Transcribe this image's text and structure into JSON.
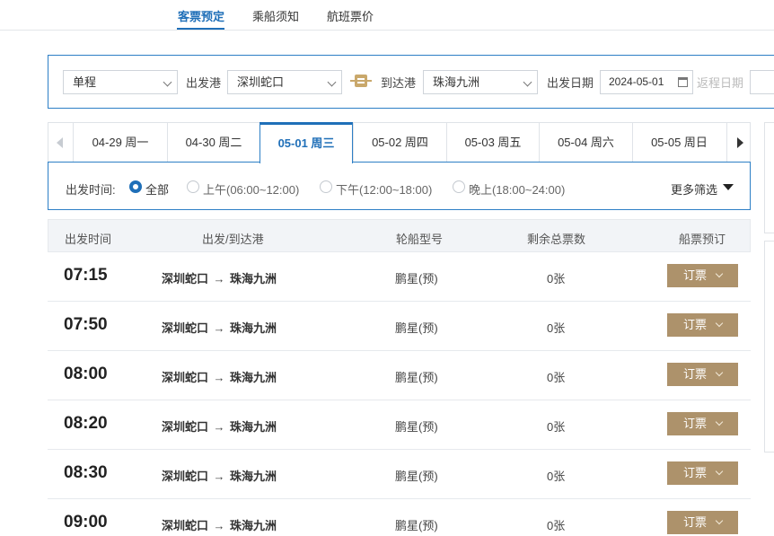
{
  "nav": {
    "items": [
      "客票预定",
      "乘船须知",
      "航班票价"
    ]
  },
  "search": {
    "trip_type": "单程",
    "depart_label": "出发港",
    "depart_value": "深圳蛇口",
    "arrive_label": "到达港",
    "arrive_value": "珠海九洲",
    "date_label": "出发日期",
    "date_value": "2024-05-01",
    "return_label": "返程日期"
  },
  "date_tabs": [
    {
      "label": "04-29 周一"
    },
    {
      "label": "04-30 周二"
    },
    {
      "label": "05-01 周三"
    },
    {
      "label": "05-02 周四"
    },
    {
      "label": "05-03 周五"
    },
    {
      "label": "05-04 周六"
    },
    {
      "label": "05-05 周日"
    }
  ],
  "active_tab": "05-01 周三",
  "filter": {
    "label": "出发时间:",
    "options": [
      {
        "label": "全部",
        "checked": true
      },
      {
        "label": "上午(06:00~12:00)",
        "checked": false
      },
      {
        "label": "下午(12:00~18:00)",
        "checked": false
      },
      {
        "label": "晚上(18:00~24:00)",
        "checked": false
      }
    ],
    "more": "更多筛选"
  },
  "table": {
    "headers": [
      "出发时间",
      "出发/到达港",
      "轮船型号",
      "剩余总票数",
      "船票预订"
    ],
    "rows": [
      {
        "time": "07:15",
        "from": "深圳蛇口",
        "to": "珠海九洲",
        "ship": "鹏星(预)",
        "remaining": "0张",
        "book": "订票"
      },
      {
        "time": "07:50",
        "from": "深圳蛇口",
        "to": "珠海九洲",
        "ship": "鹏星(预)",
        "remaining": "0张",
        "book": "订票"
      },
      {
        "time": "08:00",
        "from": "深圳蛇口",
        "to": "珠海九洲",
        "ship": "鹏星(预)",
        "remaining": "0张",
        "book": "订票"
      },
      {
        "time": "08:20",
        "from": "深圳蛇口",
        "to": "珠海九洲",
        "ship": "鹏星(预)",
        "remaining": "0张",
        "book": "订票"
      },
      {
        "time": "08:30",
        "from": "深圳蛇口",
        "to": "珠海九洲",
        "ship": "鹏星(预)",
        "remaining": "0张",
        "book": "订票"
      },
      {
        "time": "09:00",
        "from": "深圳蛇口",
        "to": "珠海九洲",
        "ship": "鹏星(预)",
        "remaining": "0张",
        "book": "订票"
      }
    ]
  },
  "colors": {
    "accent": "#1f6fb8",
    "book_button": "#ad926b",
    "swap_icon": "#c9a86b"
  }
}
